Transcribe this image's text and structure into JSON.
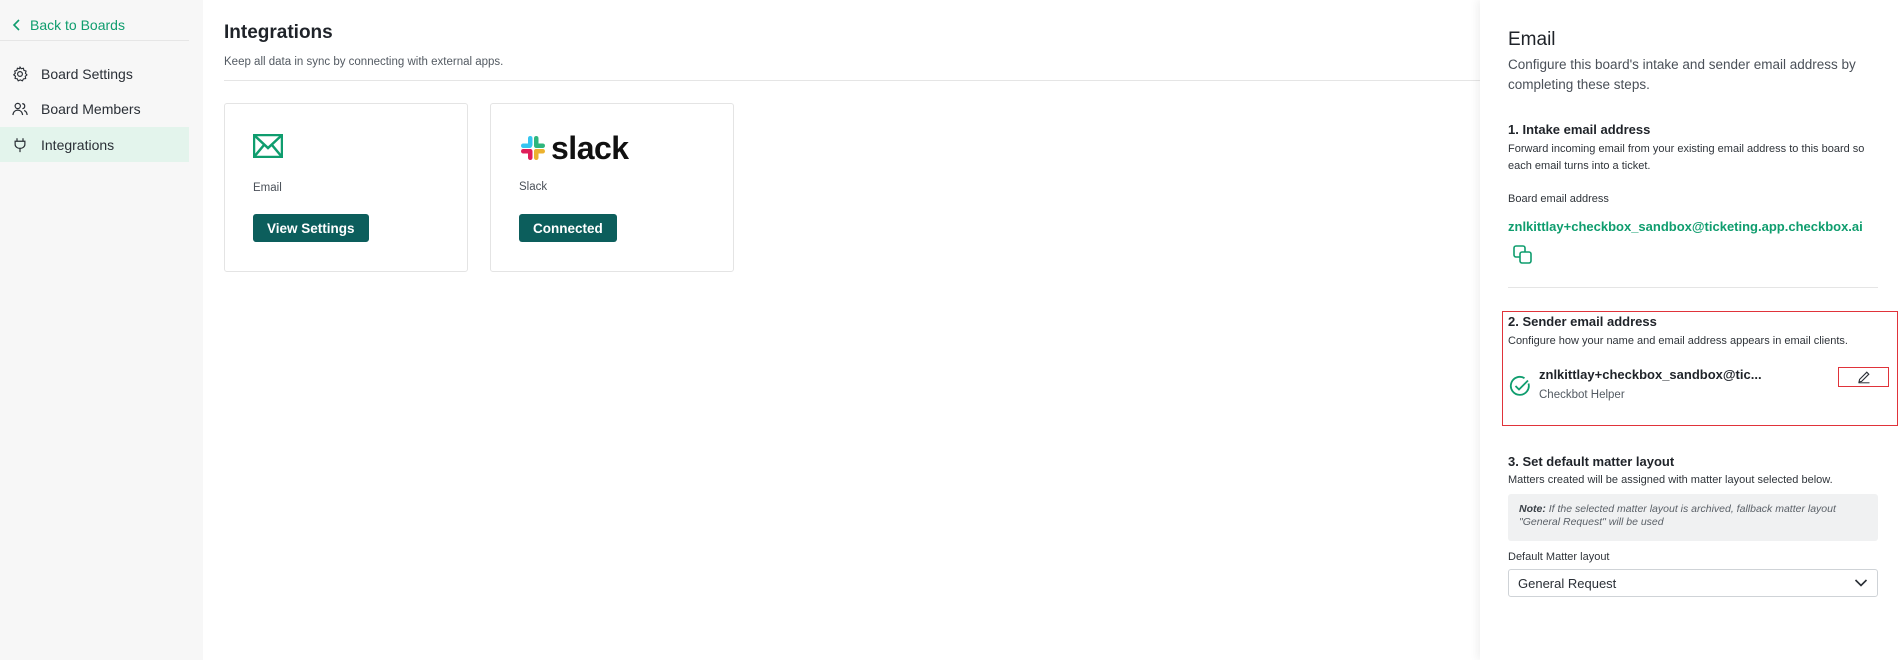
{
  "sidebar": {
    "back_label": "Back to Boards",
    "items": [
      {
        "label": "Board Settings",
        "icon": "gear-icon"
      },
      {
        "label": "Board Members",
        "icon": "users-icon"
      },
      {
        "label": "Integrations",
        "icon": "plug-icon",
        "active": true
      }
    ]
  },
  "main": {
    "title": "Integrations",
    "subtitle": "Keep all data in sync by connecting with external apps.",
    "cards": [
      {
        "label": "Email",
        "button": "View Settings",
        "icon": "envelope-icon"
      },
      {
        "label": "Slack",
        "button": "Connected",
        "logo_text": "slack",
        "icon": "slack-logo"
      }
    ]
  },
  "panel": {
    "title": "Email",
    "description": "Configure this board's intake and sender email address by completing these steps.",
    "intake": {
      "title": "1. Intake email address",
      "description": "Forward incoming email from your existing email address to this board so each email turns into a ticket.",
      "field_label": "Board email address",
      "email": "znlkittlay+checkbox_sandbox@ticketing.app.checkbox.ai"
    },
    "sender": {
      "title": "2. Sender email address",
      "description": "Configure how your name and email address appears in email clients.",
      "email": "znlkittlay+checkbox_sandbox@tic...",
      "name": "Checkbot Helper"
    },
    "layout": {
      "title": "3. Set default matter layout",
      "description": "Matters created will be assigned with matter layout selected below.",
      "note_label": "Note:",
      "note_text": " If the selected matter layout is archived, fallback matter layout \"General Request\" will be used",
      "field_label": "Default Matter layout",
      "selected": "General Request"
    }
  },
  "colors": {
    "accent": "#0f9d6e",
    "button": "#0c5e5c",
    "highlight": "#e0333a",
    "active_nav": "#e3f4ec"
  }
}
